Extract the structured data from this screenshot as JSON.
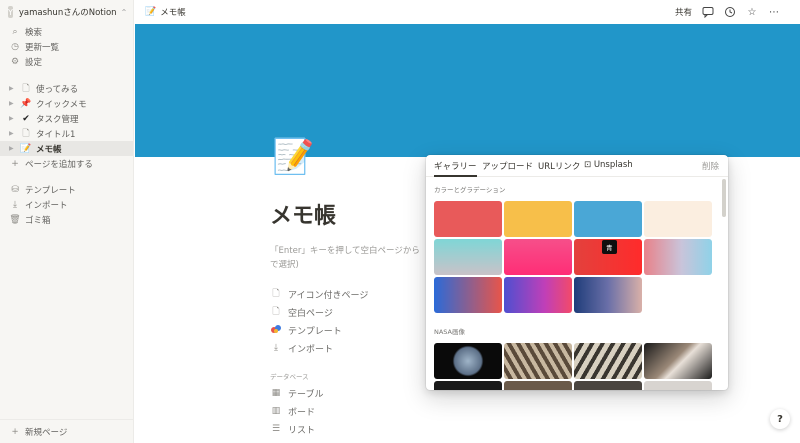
{
  "workspace": {
    "avatar": "Y",
    "name": "yamashunさんのNotion"
  },
  "sidebar": {
    "top_items": [
      {
        "label": "検索",
        "icon": "search-icon"
      },
      {
        "label": "更新一覧",
        "icon": "clock-icon"
      },
      {
        "label": "設定",
        "icon": "gear-icon"
      }
    ],
    "pages": [
      {
        "label": "使ってみる",
        "icon": "page-icon"
      },
      {
        "label": "クイックメモ",
        "icon": "pin-emoji"
      },
      {
        "label": "タスク管理",
        "icon": "checkmark-emoji"
      },
      {
        "label": "タイトル1",
        "icon": "page-icon"
      },
      {
        "label": "メモ帳",
        "icon": "memo-emoji"
      }
    ],
    "add_page": "ページを追加する",
    "tools": [
      {
        "label": "テンプレート",
        "icon": "template-icon"
      },
      {
        "label": "インポート",
        "icon": "import-icon"
      },
      {
        "label": "ゴミ箱",
        "icon": "trash-icon"
      }
    ],
    "new_page": "新規ページ"
  },
  "topbar": {
    "title": "メモ帳",
    "share": "共有"
  },
  "page": {
    "title": "メモ帳",
    "hint_line1": "「Enter」キーを押して空白ページから",
    "hint_line2": "で選択)",
    "options": [
      {
        "label": "アイコン付きページ",
        "icon": "page-icon"
      },
      {
        "label": "空白ページ",
        "icon": "page-icon"
      },
      {
        "label": "テンプレート",
        "icon": "template-icon"
      },
      {
        "label": "インポート",
        "icon": "import-icon"
      }
    ],
    "db_label": "データベース",
    "db_options": [
      {
        "label": "テーブル",
        "icon": "table-icon"
      },
      {
        "label": "ボード",
        "icon": "board-icon"
      },
      {
        "label": "リスト",
        "icon": "list-icon"
      }
    ]
  },
  "cover_picker": {
    "tabs": [
      "ギャラリー",
      "アップロード",
      "URLリンク",
      "Unsplash"
    ],
    "remove": "削除",
    "section_gradients": "カラーとグラデーション",
    "section_nasa": "NASA画像",
    "tooltip": "青",
    "colors": {
      "cover": "#2196c9",
      "swatches": [
        "#e85a5a",
        "#f7bf4a",
        "#4aa7d6",
        "#fbeee0"
      ]
    }
  },
  "help": "?"
}
